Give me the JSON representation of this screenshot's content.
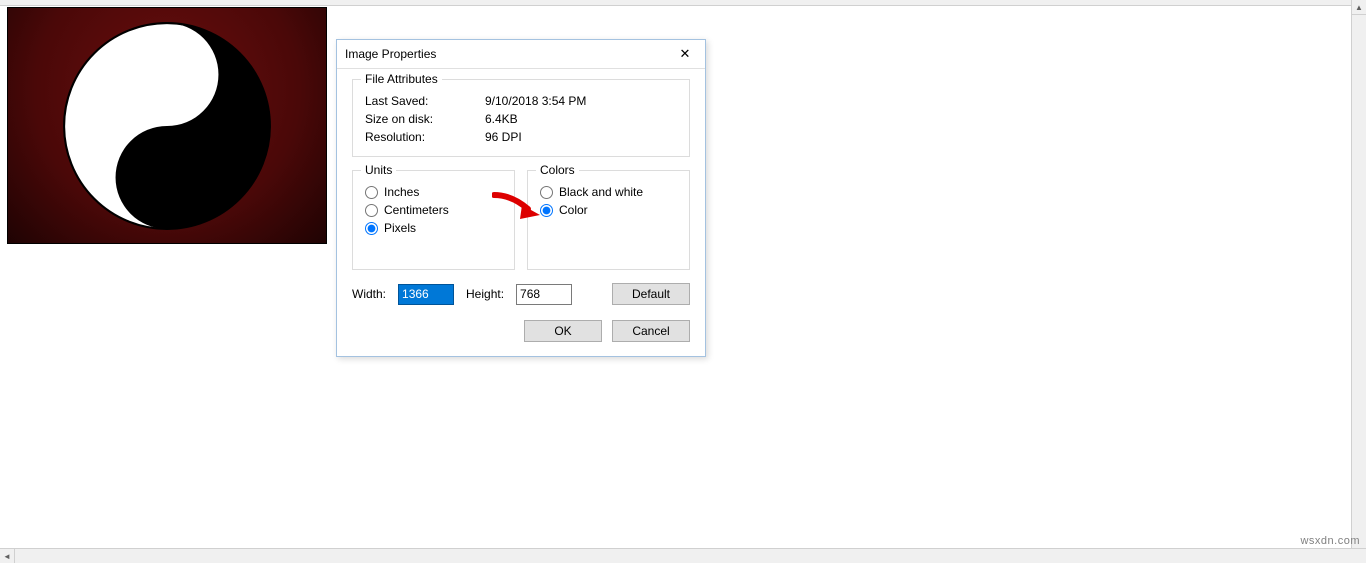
{
  "dialog": {
    "title": "Image Properties",
    "close_symbol": "✕",
    "attributes": {
      "group_label": "File Attributes",
      "last_saved_label": "Last Saved:",
      "last_saved_value": "9/10/2018 3:54 PM",
      "size_on_disk_label": "Size on disk:",
      "size_on_disk_value": "6.4KB",
      "resolution_label": "Resolution:",
      "resolution_value": "96 DPI"
    },
    "units": {
      "group_label": "Units",
      "options": {
        "inches": "Inches",
        "centimeters": "Centimeters",
        "pixels": "Pixels"
      },
      "selected": "pixels"
    },
    "colors": {
      "group_label": "Colors",
      "options": {
        "bw": "Black and white",
        "color": "Color"
      },
      "selected": "color"
    },
    "dimensions": {
      "width_label": "Width:",
      "width_value": "1366",
      "height_label": "Height:",
      "height_value": "768",
      "default_label": "Default"
    },
    "buttons": {
      "ok": "OK",
      "cancel": "Cancel"
    }
  },
  "watermark": "wsxdn.com"
}
